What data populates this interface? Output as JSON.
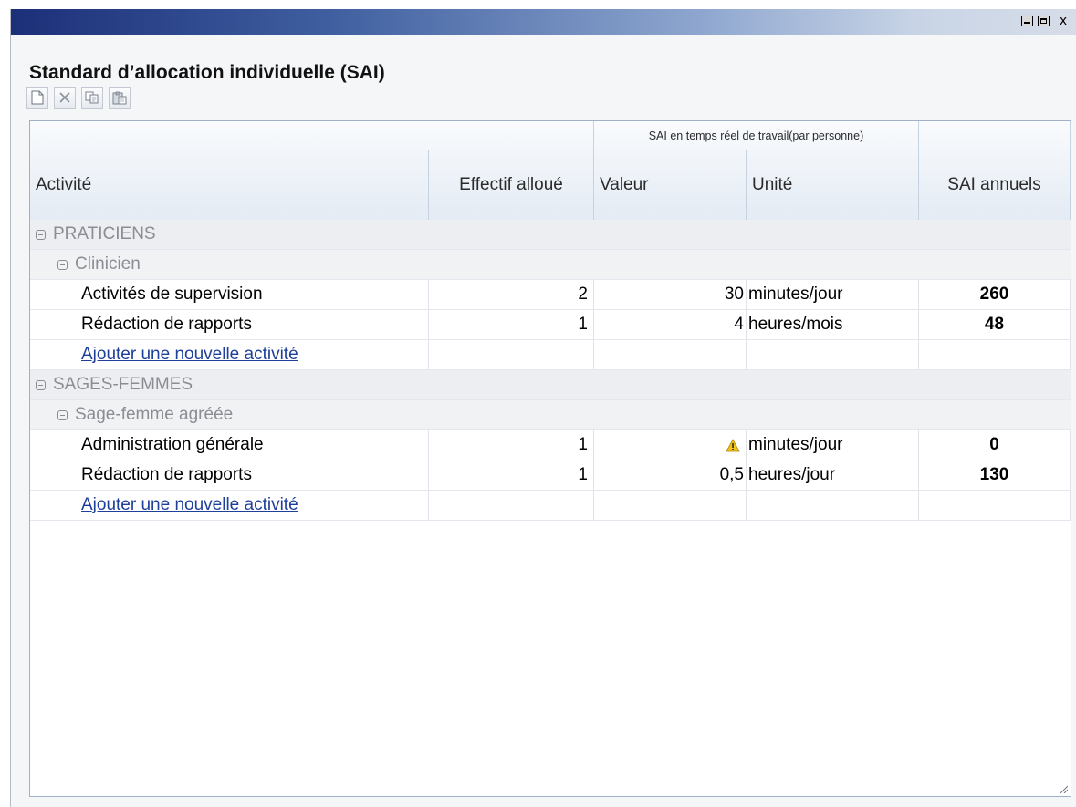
{
  "window": {
    "controls": {
      "minimize_icon": "minimize-icon",
      "maximize_icon": "maximize-icon",
      "close_label": "x"
    }
  },
  "page": {
    "title": "Standard d’allocation individuelle (SAI)"
  },
  "toolbar": {
    "buttons": [
      {
        "name": "new-button",
        "icon": "new-document-icon"
      },
      {
        "name": "delete-button",
        "icon": "delete-x-icon"
      },
      {
        "name": "copy-button",
        "icon": "copy-icon"
      },
      {
        "name": "paste-button",
        "icon": "paste-icon"
      }
    ]
  },
  "table": {
    "band_label": "SAI en temps réel de travail(par personne)",
    "columns": {
      "activity": "Activité",
      "staff": "Effectif alloué",
      "value": "Valeur",
      "unit": "Unité",
      "annual": "SAI annuels"
    },
    "groups": [
      {
        "label": "PRATICIENS",
        "subgroup": "Clinicien",
        "rows": [
          {
            "activity": "Activités de supervision",
            "staff": "2",
            "value": "30",
            "unit": "minutes/jour",
            "annual": "260"
          },
          {
            "activity": "Rédaction de rapports",
            "staff": "1",
            "value": "4",
            "unit": "heures/mois",
            "annual": "48"
          }
        ],
        "add_label": "Ajouter une nouvelle activité"
      },
      {
        "label": "SAGES-FEMMES",
        "subgroup": "Sage-femme agréée",
        "rows": [
          {
            "activity": "Administration générale",
            "staff": "1",
            "value": "",
            "unit": "minutes/jour",
            "annual": "0",
            "value_icon": "warning-icon"
          },
          {
            "activity": "Rédaction de rapports",
            "staff": "1",
            "value": "0,5",
            "unit": "heures/jour",
            "annual": "130"
          }
        ],
        "add_label": "Ajouter une nouvelle activité"
      }
    ]
  },
  "colors": {
    "titlebar_start": "#1c2f78",
    "link": "#1e3f9a",
    "group_text": "#8a8e94",
    "warning": "#f0c419"
  }
}
